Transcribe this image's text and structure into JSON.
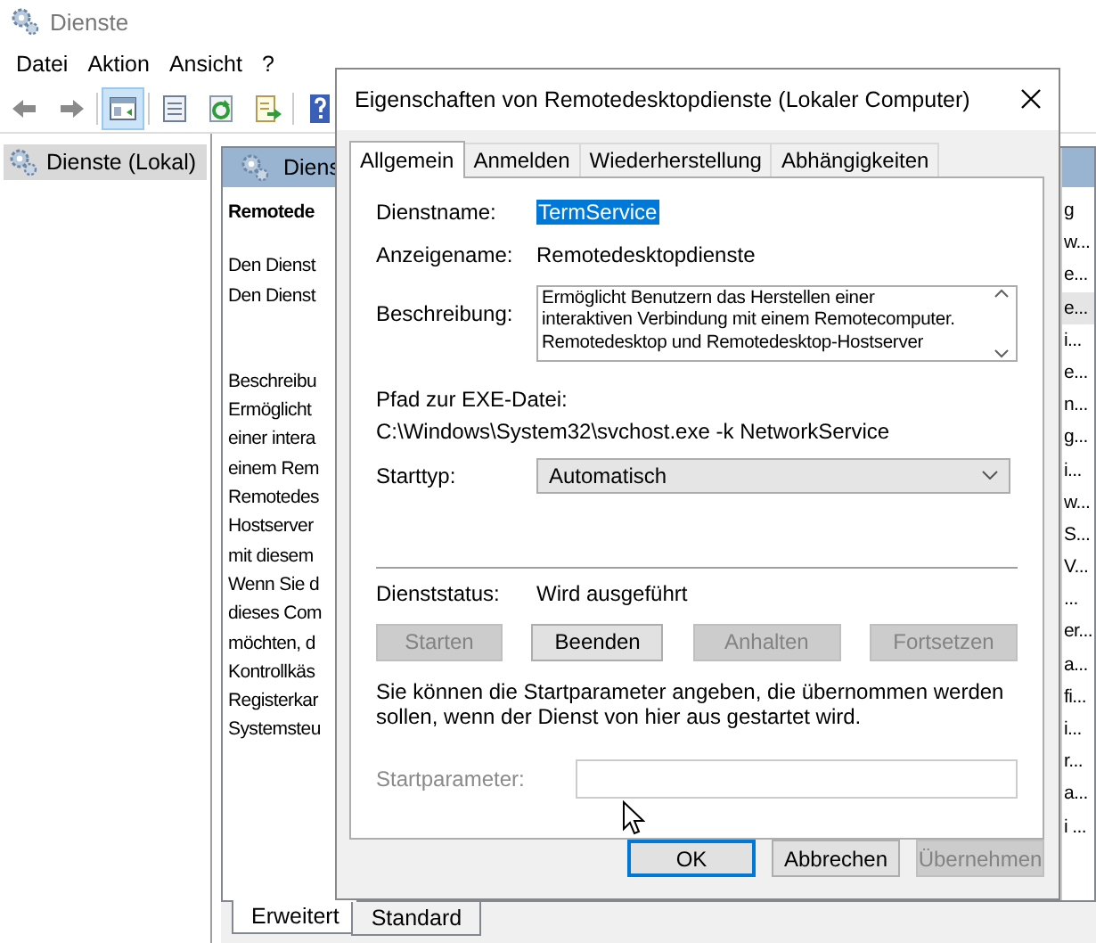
{
  "window": {
    "title": "Dienste"
  },
  "menu": [
    "Datei",
    "Aktion",
    "Ansicht",
    "?"
  ],
  "toolbar": [
    {
      "kind": "back",
      "pressed": false
    },
    {
      "kind": "forward",
      "pressed": false
    },
    {
      "kind": "tree",
      "pressed": true
    },
    {
      "kind": "properties",
      "pressed": false
    },
    {
      "kind": "refresh",
      "pressed": false
    },
    {
      "kind": "export",
      "pressed": false
    },
    {
      "kind": "help",
      "pressed": false
    }
  ],
  "tree": {
    "items": [
      {
        "label": "Dienste (Lokal)",
        "selected": true
      }
    ]
  },
  "detail": {
    "header": "Diens",
    "title": "Remotede",
    "links": [
      "Den Dienst",
      "Den Dienst"
    ],
    "description_lines": [
      "Beschreibu",
      "Ermöglicht",
      "einer intera",
      "einem Rem",
      "Remotedes",
      "Hostserver",
      "mit diesem",
      "Wenn Sie d",
      "dieses Com",
      "möchten, d",
      "Kontrollkäs",
      "Registerkar",
      "Systemsteu"
    ]
  },
  "list_column": {
    "cells": [
      {
        "text": "g",
        "selected": false
      },
      {
        "text": "w...",
        "selected": false
      },
      {
        "text": "e...",
        "selected": false
      },
      {
        "text": "e...",
        "selected": true
      },
      {
        "text": "i...",
        "selected": false
      },
      {
        "text": "e...",
        "selected": false
      },
      {
        "text": "n...",
        "selected": false
      },
      {
        "text": "g...",
        "selected": false
      },
      {
        "text": "i...",
        "selected": false
      },
      {
        "text": "w...",
        "selected": false
      },
      {
        "text": "S...",
        "selected": false
      },
      {
        "text": "V...",
        "selected": false
      },
      {
        "text": "...",
        "selected": false
      },
      {
        "text": "er...",
        "selected": false
      },
      {
        "text": "a...",
        "selected": false
      },
      {
        "text": "fi...",
        "selected": false
      },
      {
        "text": "i...",
        "selected": false
      },
      {
        "text": "r...",
        "selected": false
      },
      {
        "text": "a...",
        "selected": false
      },
      {
        "text": "i ...",
        "selected": false
      }
    ]
  },
  "view_tabs": [
    {
      "label": "Erweitert",
      "selected": true
    },
    {
      "label": "Standard",
      "selected": false
    }
  ],
  "dialog": {
    "title": "Eigenschaften von Remotedesktopdienste (Lokaler Computer)",
    "tabs": [
      {
        "label": "Allgemein",
        "selected": true
      },
      {
        "label": "Anmelden",
        "selected": false
      },
      {
        "label": "Wiederherstellung",
        "selected": false
      },
      {
        "label": "Abhängigkeiten",
        "selected": false
      }
    ],
    "service_name": {
      "label": "Dienstname:",
      "value": "TermService"
    },
    "display_name": {
      "label": "Anzeigename:",
      "value": "Remotedesktopdienste"
    },
    "description": {
      "label": "Beschreibung:",
      "lines": [
        "Ermöglicht Benutzern das Herstellen einer",
        "interaktiven Verbindung mit einem Remotecomputer.",
        "Remotedesktop und Remotedesktop-Hostserver"
      ]
    },
    "exe_path": {
      "label": "Pfad zur EXE-Datei:",
      "value": "C:\\Windows\\System32\\svchost.exe -k NetworkService"
    },
    "startup_type": {
      "label": "Starttyp:",
      "value": "Automatisch"
    },
    "status": {
      "label": "Dienststatus:",
      "value": "Wird ausgeführt"
    },
    "service_buttons": [
      {
        "label": "Starten",
        "disabled": true
      },
      {
        "label": "Beenden",
        "disabled": false
      },
      {
        "label": "Anhalten",
        "disabled": true
      },
      {
        "label": "Fortsetzen",
        "disabled": true
      }
    ],
    "hint": "Sie können die Startparameter angeben, die übernommen werden sollen, wenn der Dienst von hier aus gestartet wird.",
    "start_parameters": {
      "label": "Startparameter:",
      "disabled": true
    },
    "buttons": [
      {
        "label": "OK",
        "default": true,
        "disabled": false
      },
      {
        "label": "Abbrechen",
        "default": false,
        "disabled": false
      },
      {
        "label": "Übernehmen",
        "default": false,
        "disabled": true
      }
    ]
  }
}
